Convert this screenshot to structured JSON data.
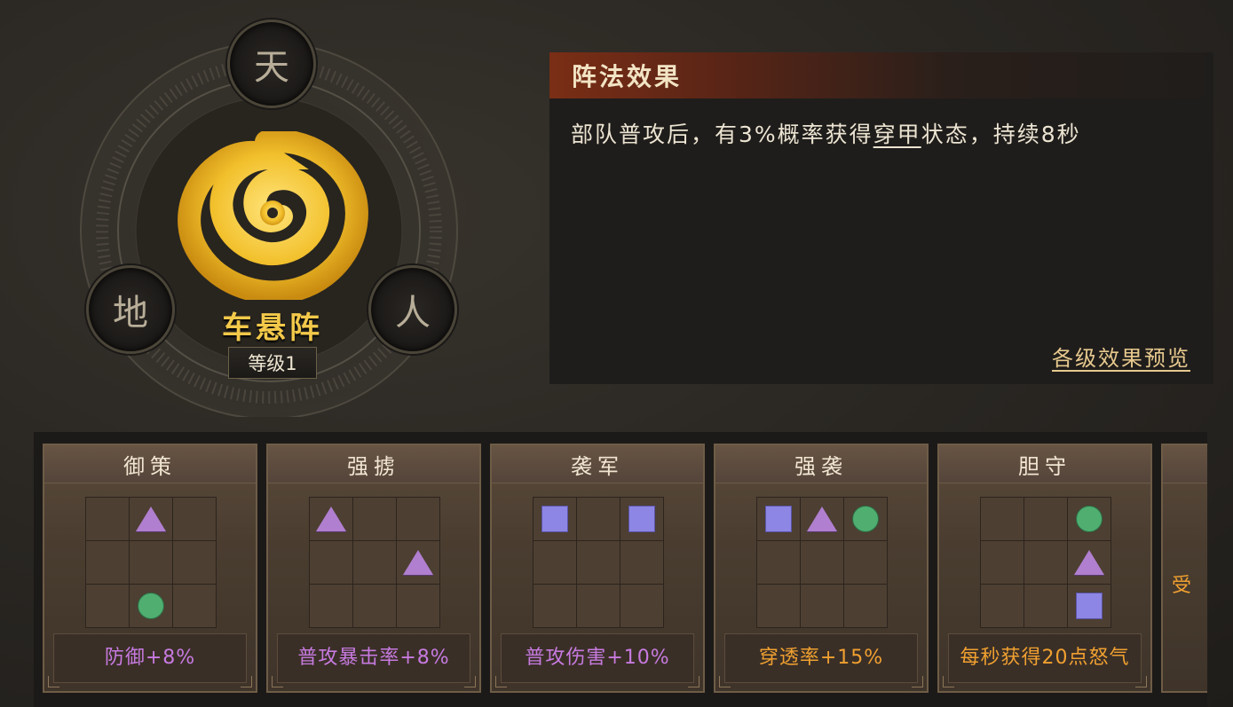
{
  "formation": {
    "name": "车悬阵",
    "level": "等级1",
    "nodes": {
      "top": "天",
      "left": "地",
      "right": "人"
    }
  },
  "effect": {
    "header": "阵法效果",
    "text_before": "部队普攻后，有3%概率获得",
    "keyword": "穿甲",
    "text_after": "状态，持续8秒",
    "preview_link": "各级效果预览"
  },
  "cards": [
    {
      "title": "御策",
      "bonus": "防御+8%",
      "bonus_color": "purple",
      "grid": [
        "",
        "tri",
        "",
        "",
        "",
        "",
        "",
        "circ",
        ""
      ]
    },
    {
      "title": "强掳",
      "bonus": "普攻暴击率+8%",
      "bonus_color": "purple",
      "grid": [
        "tri",
        "",
        "",
        "",
        "",
        "tri",
        "",
        "",
        ""
      ]
    },
    {
      "title": "袭军",
      "bonus": "普攻伤害+10%",
      "bonus_color": "purple",
      "grid": [
        "sq",
        "",
        "sq",
        "",
        "",
        "",
        "",
        "",
        ""
      ]
    },
    {
      "title": "强袭",
      "bonus": "穿透率+15%",
      "bonus_color": "orange",
      "grid": [
        "sq",
        "tri",
        "circ",
        "",
        "",
        "",
        "",
        "",
        ""
      ]
    },
    {
      "title": "胆守",
      "bonus": "每秒获得20点怒气",
      "bonus_color": "orange",
      "grid": [
        "",
        "",
        "circ",
        "",
        "",
        "tri",
        "",
        "",
        "sq"
      ]
    },
    {
      "title": "",
      "bonus": "受",
      "bonus_color": "orange",
      "grid": []
    }
  ],
  "colors": {
    "accent_gold": "#f3c94a",
    "purple": "#c77ae0",
    "orange": "#f0a030"
  }
}
